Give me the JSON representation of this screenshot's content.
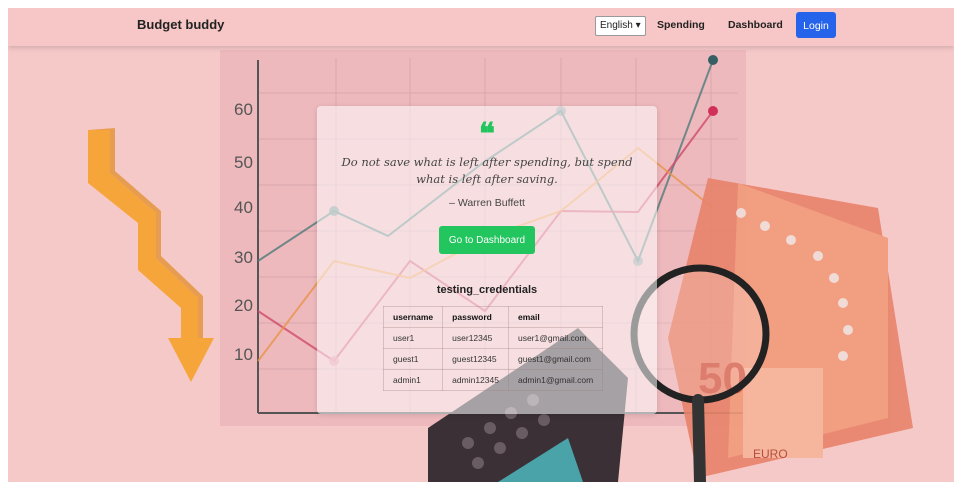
{
  "nav": {
    "brand": "Budget buddy",
    "language": "English",
    "links": [
      "Spending",
      "Dashboard"
    ],
    "login_label": "Login"
  },
  "background": {
    "y_tick_labels": [
      "60",
      "50",
      "40",
      "30",
      "20",
      "10"
    ]
  },
  "card": {
    "quote_mark": "❝",
    "quote": "Do not save what is left after spending, but spend what is left after saving.",
    "author": "– Warren Buffett",
    "dashboard_button": "Go to Dashboard",
    "credentials_title": "testing_credentials",
    "table": {
      "headers": [
        "username",
        "password",
        "email"
      ],
      "rows": [
        [
          "user1",
          "user12345",
          "user1@gmail.com"
        ],
        [
          "guest1",
          "guest12345",
          "guest1@gmail.com"
        ],
        [
          "admin1",
          "admin12345",
          "admin1@gmail.com"
        ]
      ]
    }
  },
  "colors": {
    "brand_bg": "#f7c6c6",
    "login": "#2563eb",
    "accent": "#22c55e"
  }
}
